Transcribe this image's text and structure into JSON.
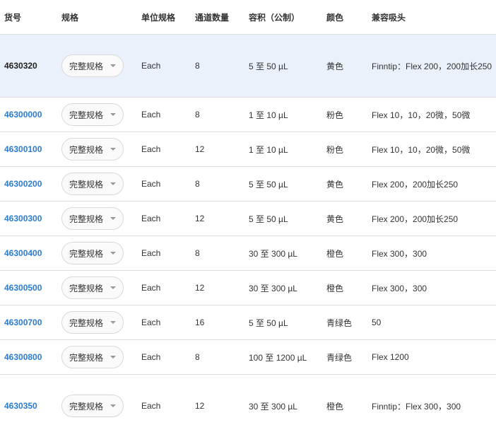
{
  "headers": [
    "货号",
    "规格",
    "单位规格",
    "通道数量",
    "容积（公制）",
    "颜色",
    "兼容吸头"
  ],
  "spec_button_label": "完整规格",
  "rows": [
    {
      "sku": "4630320",
      "unit": "Each",
      "channels": "8",
      "volume": "5 至 50 µL",
      "color": "黄色",
      "tips": "Finntip：Flex 200，200加长250"
    },
    {
      "sku": "46300000",
      "unit": "Each",
      "channels": "8",
      "volume": "1 至 10 µL",
      "color": "粉色",
      "tips": "Flex 10，10，20微，50微"
    },
    {
      "sku": "46300100",
      "unit": "Each",
      "channels": "12",
      "volume": "1 至 10 µL",
      "color": "粉色",
      "tips": "Flex 10，10，20微，50微"
    },
    {
      "sku": "46300200",
      "unit": "Each",
      "channels": "8",
      "volume": "5 至 50 µL",
      "color": "黄色",
      "tips": "Flex 200，200加长250"
    },
    {
      "sku": "46300300",
      "unit": "Each",
      "channels": "12",
      "volume": "5 至 50 µL",
      "color": "黄色",
      "tips": "Flex 200，200加长250"
    },
    {
      "sku": "46300400",
      "unit": "Each",
      "channels": "8",
      "volume": "30 至 300 µL",
      "color": "橙色",
      "tips": "Flex 300，300"
    },
    {
      "sku": "46300500",
      "unit": "Each",
      "channels": "12",
      "volume": "30 至 300 µL",
      "color": "橙色",
      "tips": "Flex 300，300"
    },
    {
      "sku": "46300700",
      "unit": "Each",
      "channels": "16",
      "volume": "5 至 50 µL",
      "color": "青绿色",
      "tips": "50"
    },
    {
      "sku": "46300800",
      "unit": "Each",
      "channels": "8",
      "volume": "100 至 1200 µL",
      "color": "青绿色",
      "tips": "Flex 1200"
    },
    {
      "sku": "4630350",
      "unit": "Each",
      "channels": "12",
      "volume": "30 至 300 µL",
      "color": "橙色",
      "tips": "Finntip：Flex 300，300"
    }
  ],
  "colors": {
    "link": "#2b7bd0",
    "highlight_row": "#eaf1fb",
    "divider": "#dddddd"
  },
  "icons": {
    "dropdown": "chevron-down-icon"
  }
}
